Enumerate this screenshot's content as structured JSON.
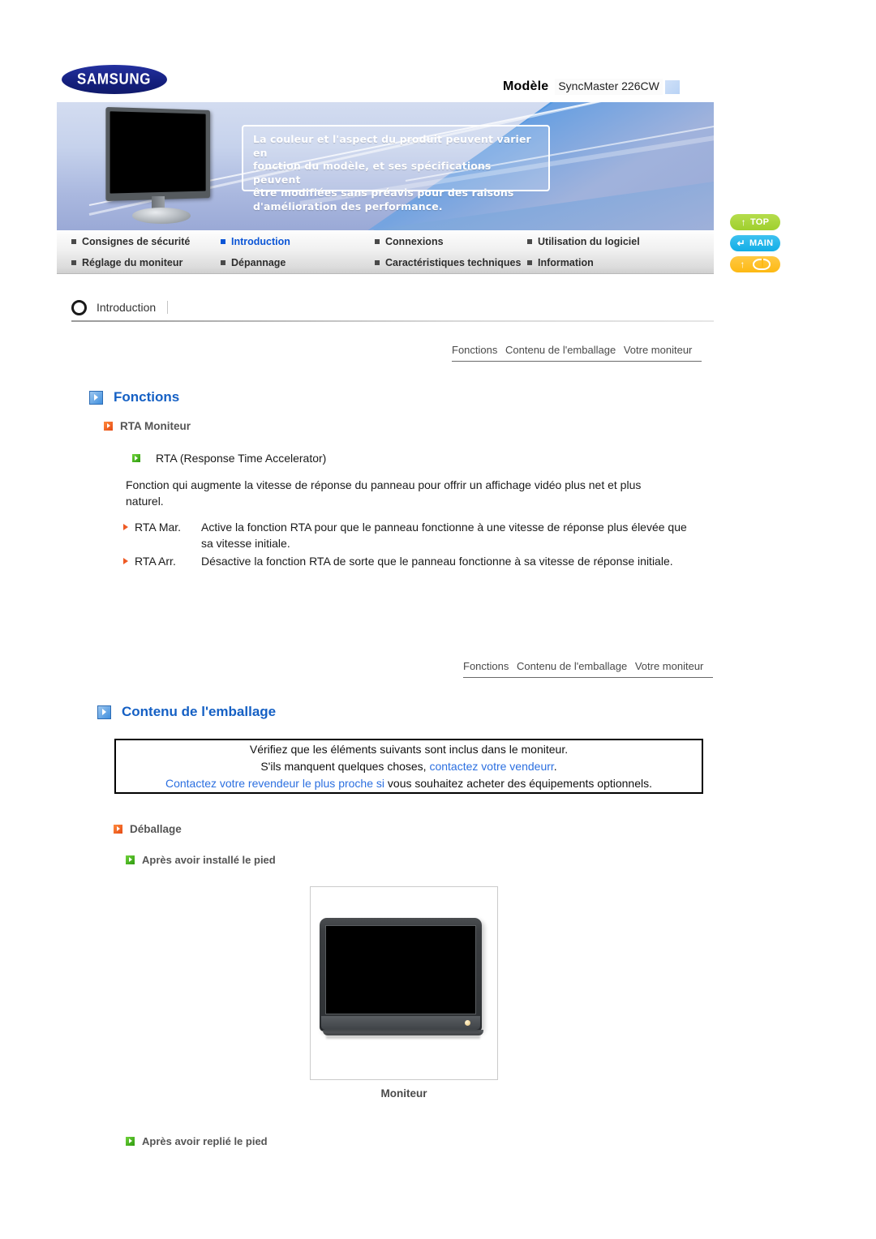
{
  "header": {
    "brand": "SAMSUNG",
    "model_label": "Modèle",
    "model_value": "SyncMaster 226CW"
  },
  "banner": {
    "notice_lines": [
      "La couleur et l'aspect du produit peuvent varier en",
      "fonction du modèle, et ses spécifications peuvent",
      "être modifiées sans préavis pour des raisons",
      "d'amélioration des performance."
    ]
  },
  "nav": {
    "row1": [
      {
        "label": "Consignes de sécurité",
        "active": false
      },
      {
        "label": "Introduction",
        "active": true
      },
      {
        "label": "Connexions",
        "active": false
      },
      {
        "label": "Utilisation du logiciel",
        "active": false
      }
    ],
    "row2": [
      {
        "label": "Réglage du moniteur",
        "active": false
      },
      {
        "label": "Dépannage",
        "active": false
      },
      {
        "label": "Caractéristiques techniques",
        "active": false
      },
      {
        "label": "Information",
        "active": false
      }
    ]
  },
  "side_buttons": [
    {
      "label": "TOP",
      "color": "#9fcf2e"
    },
    {
      "label": "MAIN",
      "color": "#12aee6"
    },
    {
      "label": "",
      "color": "#fdb913"
    }
  ],
  "section": {
    "tab_label": "Introduction"
  },
  "breadcrumbs": [
    "Fonctions",
    "Contenu de l'emballage",
    "Votre moniteur"
  ],
  "fonctions": {
    "title": "Fonctions",
    "sub_title": "RTA Moniteur",
    "rta_title": "RTA (Response Time Accelerator)",
    "paragraph": "Fonction qui augmente la vitesse de réponse du panneau pour offrir un affichage vidéo plus net et plus naturel.",
    "definitions": [
      {
        "term": "RTA Mar.",
        "desc": "Active la fonction RTA pour que le panneau fonctionne à une vitesse de réponse plus élevée que sa vitesse initiale."
      },
      {
        "term": "RTA Arr.",
        "desc": "Désactive la fonction RTA de sorte que le panneau fonctionne à sa vitesse de réponse initiale."
      }
    ]
  },
  "contenu": {
    "title": "Contenu de l'emballage",
    "note_line1": "Vérifiez que les éléments suivants sont inclus dans le moniteur.",
    "note_line2_pre": "S'ils manquent quelques choses, ",
    "note_line2_link": "contactez votre vendeurr",
    "note_line2_post": ".",
    "note_line3_link": "Contactez votre revendeur le plus proche si",
    "note_line3_post": " vous souhaitez acheter des équipements optionnels.",
    "deballage_title": "Déballage",
    "sub_installed": "Après avoir installé le pied",
    "figure_caption": "Moniteur",
    "sub_folded": "Après avoir replié le pied"
  },
  "colors": {
    "heading_blue": "#1560c4",
    "link_blue": "#2b6fe0",
    "nav_active": "#0b55d6",
    "orange": "#e54a14",
    "green": "#2f9b10"
  }
}
